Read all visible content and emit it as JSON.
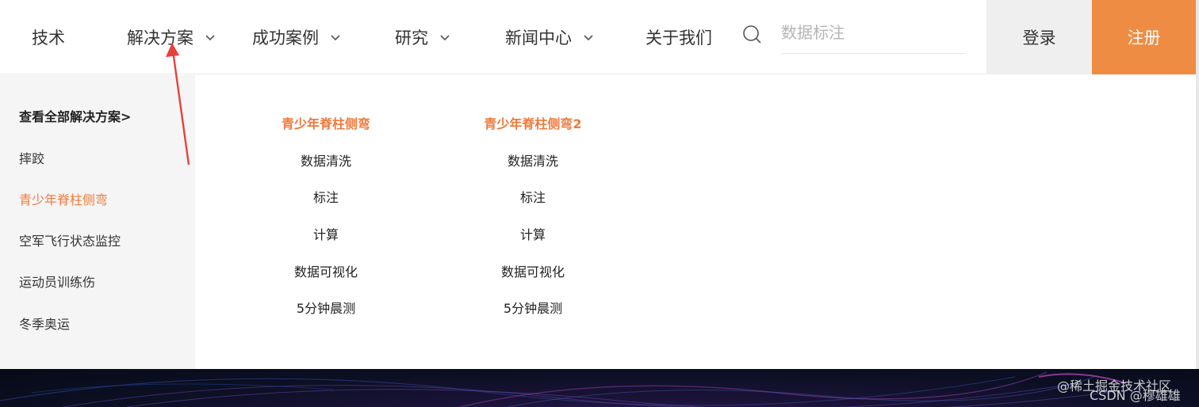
{
  "nav": {
    "items": [
      {
        "label": "技术",
        "has_dropdown": false
      },
      {
        "label": "解决方案",
        "has_dropdown": true
      },
      {
        "label": "成功案例",
        "has_dropdown": true
      },
      {
        "label": "研究",
        "has_dropdown": true
      },
      {
        "label": "新闻中心",
        "has_dropdown": true
      },
      {
        "label": "关于我们",
        "has_dropdown": false
      }
    ],
    "search_placeholder": "数据标注",
    "login_label": "登录",
    "register_label": "注册"
  },
  "dropdown": {
    "sidebar": [
      {
        "label": "查看全部解决方案>",
        "style": "bold"
      },
      {
        "label": "摔跤",
        "style": "normal"
      },
      {
        "label": "青少年脊柱侧弯",
        "style": "active"
      },
      {
        "label": "空军飞行状态监控",
        "style": "normal"
      },
      {
        "label": "运动员训练伤",
        "style": "normal"
      },
      {
        "label": "冬季奥运",
        "style": "normal"
      }
    ],
    "columns": [
      {
        "title": "青少年脊柱侧弯",
        "links": [
          "数据清洗",
          "标注",
          "计算",
          "数据可视化",
          "5分钟晨测"
        ]
      },
      {
        "title": "青少年脊柱侧弯2",
        "links": [
          "数据清洗",
          "标注",
          "计算",
          "数据可视化",
          "5分钟晨测"
        ]
      }
    ]
  },
  "footer": {
    "watermark_1": "@稀土掘金技术社区",
    "watermark_2": "CSDN @穆雄雄"
  },
  "colors": {
    "accent": "#ef7a3c",
    "register_bg": "#ee8c43",
    "sidebar_bg": "#f5f5f5",
    "login_bg": "#efefef",
    "annotation_arrow": "#e8413c"
  }
}
